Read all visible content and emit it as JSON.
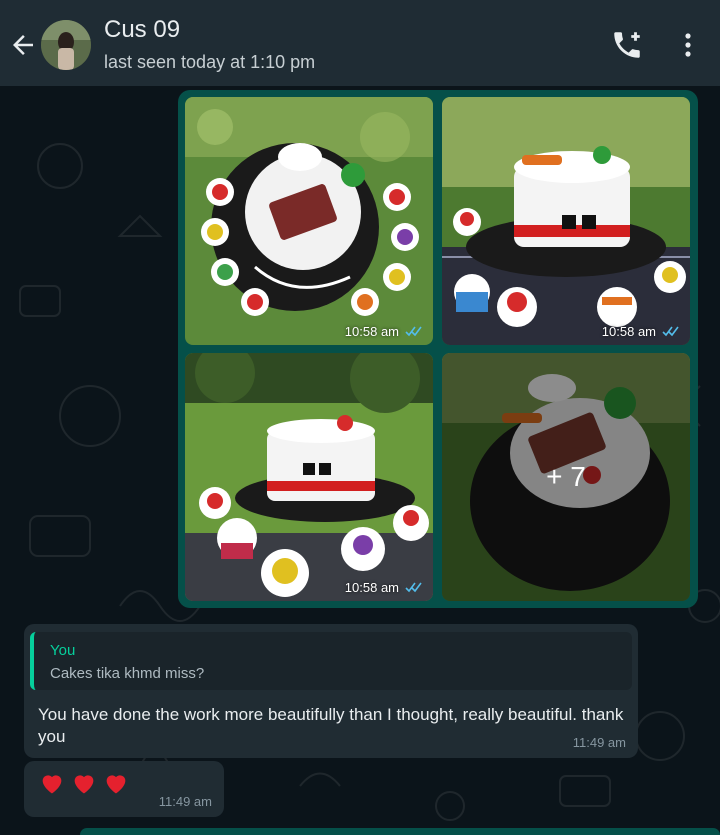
{
  "header": {
    "contact_name": "Cus 09",
    "status": "last seen today at 1:10 pm"
  },
  "media": {
    "tiles": [
      {
        "time": "10:58 am"
      },
      {
        "time": "10:58 am"
      },
      {
        "time": "10:58 am"
      }
    ],
    "more_count": "+ 7"
  },
  "messages": {
    "reply": {
      "quoted_author": "You",
      "quoted_text": "Cakes tika khmd miss?",
      "text": "You have done the work more beautifully than I thought, really beautiful. thank you",
      "time": "11:49 am"
    },
    "hearts": {
      "emoji": "❤️❤️❤️",
      "time": "11:49 am"
    }
  },
  "colors": {
    "header_bg": "#1f2c34",
    "chat_bg": "#0b141a",
    "outgoing_bubble": "#055049",
    "incoming_bubble": "#202c33",
    "accent": "#06cf9c",
    "read_ticks": "#53bdeb"
  },
  "icons": [
    "back-arrow-icon",
    "add-call-icon",
    "more-vert-icon",
    "double-tick-icon",
    "heart-icon"
  ]
}
